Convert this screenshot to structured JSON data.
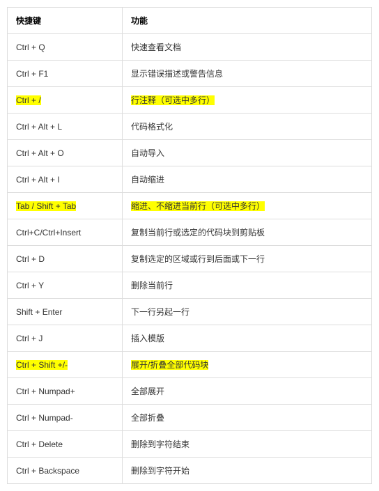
{
  "headers": {
    "shortcut": "快捷键",
    "function": "功能"
  },
  "rows": [
    {
      "shortcut": "Ctrl + Q",
      "function": "快速查看文档",
      "highlight": false
    },
    {
      "shortcut": "Ctrl + F1",
      "function": "显示错误描述或警告信息",
      "highlight": false
    },
    {
      "shortcut": "Ctrl + /",
      "function": "行注释（可选中多行）",
      "highlight": true
    },
    {
      "shortcut": "Ctrl + Alt + L",
      "function": "代码格式化",
      "highlight": false
    },
    {
      "shortcut": "Ctrl + Alt + O",
      "function": "自动导入",
      "highlight": false
    },
    {
      "shortcut": "Ctrl + Alt + I",
      "function": "自动缩进",
      "highlight": false
    },
    {
      "shortcut": "Tab / Shift + Tab",
      "function": "缩进、不缩进当前行（可选中多行）",
      "highlight": true
    },
    {
      "shortcut": "Ctrl+C/Ctrl+Insert",
      "function": "复制当前行或选定的代码块到剪贴板",
      "highlight": false
    },
    {
      "shortcut": "Ctrl + D",
      "function": "复制选定的区域或行到后面或下一行",
      "highlight": false
    },
    {
      "shortcut": "Ctrl + Y",
      "function": "删除当前行",
      "highlight": false
    },
    {
      "shortcut": "Shift + Enter",
      "function": "下一行另起一行",
      "highlight": false
    },
    {
      "shortcut": "Ctrl + J",
      "function": "插入模版",
      "highlight": false
    },
    {
      "shortcut": "Ctrl + Shift +/-",
      "function": "展开/折叠全部代码块",
      "highlight": true
    },
    {
      "shortcut": "Ctrl + Numpad+",
      "function": "全部展开",
      "highlight": false
    },
    {
      "shortcut": "Ctrl + Numpad-",
      "function": "全部折叠",
      "highlight": false
    },
    {
      "shortcut": "Ctrl + Delete",
      "function": "删除到字符结束",
      "highlight": false
    },
    {
      "shortcut": "Ctrl + Backspace",
      "function": "删除到字符开始",
      "highlight": false
    }
  ]
}
